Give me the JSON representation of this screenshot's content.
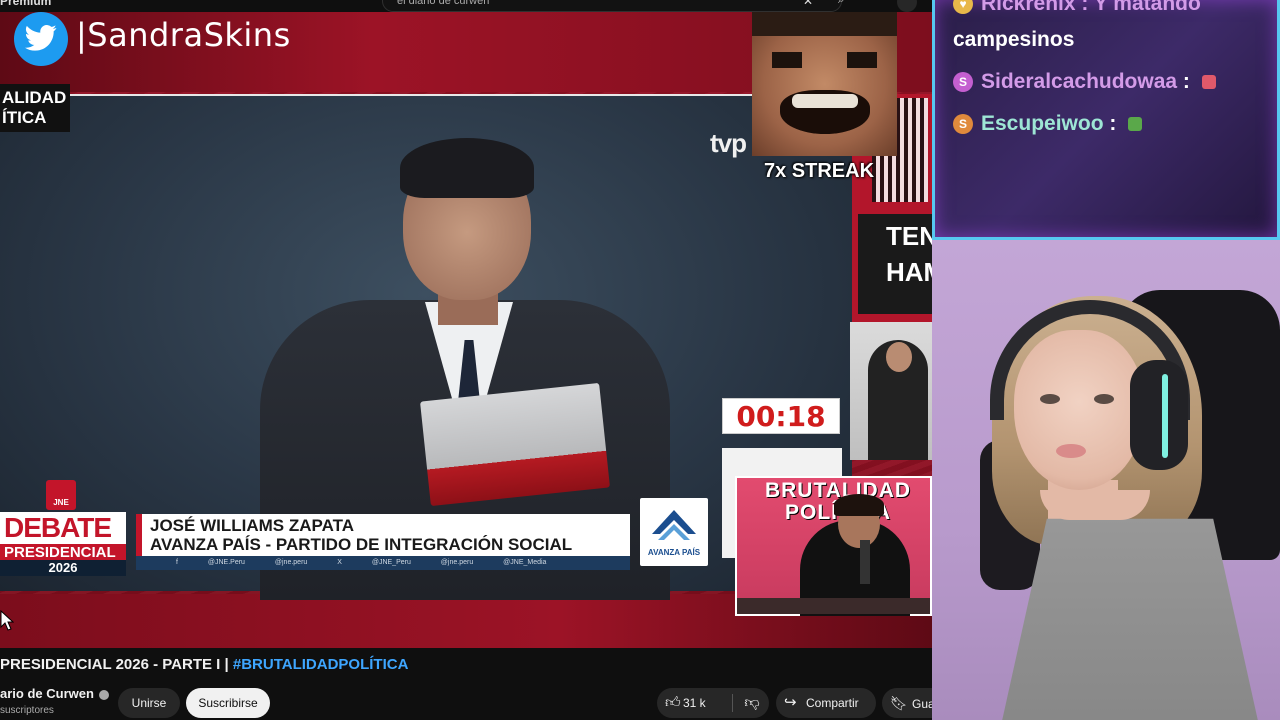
{
  "youtube": {
    "premium_label": "Premium",
    "search_query": "el diario de curwen",
    "search_close": "✕",
    "search_button": "⌕"
  },
  "overlay": {
    "twitter_handle": "|SandraSkins",
    "streak_text": "7x STREAK",
    "left_logo_text": "ALIDAD\nÍTICA",
    "right_promo_text": "TEN\nHAM",
    "tv_logo": "tvp"
  },
  "broadcast": {
    "timer": "00:18",
    "debate_word": "DEBATE",
    "presidencial_word": "PRESIDENCIAL",
    "year": "2026",
    "jne_badge": "JNE",
    "candidate_name": "JOSÉ WILLIAMS ZAPATA",
    "party_name": "AVANZA PAÍS - PARTIDO DE INTEGRACIÓN SOCIAL",
    "social_bar": "f @JNE.Peru  @jne.peru  X @JNE_Peru  @jne.peru  @JNE_Media",
    "party_logo_text": "AVANZA PAÍS",
    "inset_title": "BRUTALIDAD POLÍTICA"
  },
  "video_info": {
    "title_text": "PRESIDENCIAL 2026 - PARTE I | ",
    "title_hashtag": "#BRUTALIDADPOLÍTICA",
    "channel_name": "ario de Curwen",
    "subscribers": "suscriptores",
    "join_label": "Unirse",
    "subscribe_label": "Suscribirse",
    "like_count": "31 k",
    "share_label": "Compartir",
    "save_label": "Gua"
  },
  "chat": {
    "messages": [
      {
        "user": "Rickrenix",
        "text": "Y matando campesinos",
        "badge_color": "#e8b84a",
        "user_color": "#d39be8"
      },
      {
        "user": "Sideralcachudowaa",
        "text": "",
        "badge_color": "#c45fd0",
        "user_color": "#d39be8",
        "emote_color": "#e0596a"
      },
      {
        "user": "Escupeiwoo",
        "text": "",
        "badge_color": "#e08a3c",
        "user_color": "#9ee6d5",
        "emote_color": "#5aa84a"
      }
    ],
    "separator": ":",
    "line1_user_partial": "Rickrenix : Y matando",
    "line1_continuation": "campesinos",
    "badge_s": "S"
  },
  "colors": {
    "brand_red": "#c3152a",
    "youtube_bg": "#0f0f0f",
    "twitter_blue": "#1d9bf0",
    "chat_border": "#56c8f0",
    "hashtag_blue": "#3ea6ff",
    "timer_red": "#d01c1c"
  },
  "icons": [
    "twitter-icon",
    "search-icon",
    "close-icon",
    "mic-icon",
    "verified-icon",
    "like-icon",
    "dislike-icon",
    "share-icon",
    "save-icon",
    "cursor-icon"
  ]
}
